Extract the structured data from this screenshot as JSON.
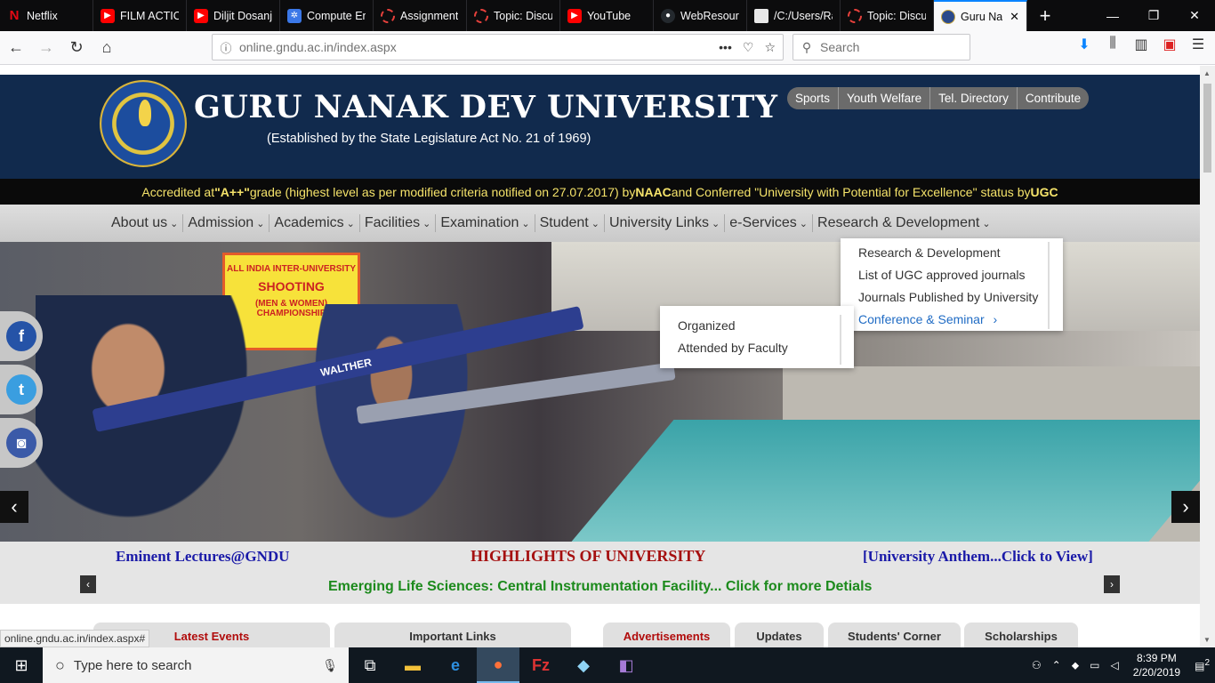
{
  "browser": {
    "tabs": [
      {
        "label": "Netflix",
        "icon": "netflix-icon"
      },
      {
        "label": "FILM ACTIO",
        "icon": "youtube-icon"
      },
      {
        "label": "Diljit Dosanj",
        "icon": "youtube-icon"
      },
      {
        "label": "Compute En",
        "icon": "chip-icon"
      },
      {
        "label": "Assignment",
        "icon": "ring-icon"
      },
      {
        "label": "Topic: Discu",
        "icon": "ring-icon"
      },
      {
        "label": "YouTube",
        "icon": "youtube-icon"
      },
      {
        "label": "WebResour",
        "icon": "github-icon"
      },
      {
        "label": "/C:/Users/Rajwi",
        "icon": "document-icon"
      },
      {
        "label": "Topic: Discu",
        "icon": "ring-icon"
      },
      {
        "label": "Guru Na",
        "icon": "gndu-icon",
        "active": true
      }
    ],
    "url_domain": "online.gndu.ac.in",
    "url_path": "/index.aspx",
    "search_placeholder": "Search",
    "status_url": "online.gndu.ac.in/index.aspx#"
  },
  "header": {
    "title": "GURU NANAK DEV UNIVERSITY",
    "subtitle": "(Established by the State Legislature Act No. 21 of 1969)",
    "top_links": [
      "Sports",
      "Youth Welfare",
      "Tel. Directory",
      "Contribute"
    ]
  },
  "ticker": {
    "p1": "Accredited at ",
    "p2": "\"A++\"",
    "p3": " grade (highest level as per modified criteria notified on 27.07.2017) by ",
    "p4": "NAAC",
    "p5": " and Conferred \"University with Potential for Excellence\" status by ",
    "p6": "UGC"
  },
  "menu": [
    "About us",
    "Admission",
    "Academics",
    "Facilities",
    "Examination",
    "Student",
    "University Links",
    "e-Services",
    "Research & Development"
  ],
  "research_dropdown": [
    "Research & Development",
    "List of UGC approved journals",
    "Journals Published by University",
    "Conference & Seminar"
  ],
  "conference_submenu": [
    "Organized",
    "Attended by Faculty"
  ],
  "hero": {
    "banner_line1": "ALL INDIA INTER-UNIVERSITY",
    "banner_line2": "SHOOTING",
    "banner_line3": "(MEN & WOMEN) CHAMPIONSHIP",
    "rifle_text": "WALTHER"
  },
  "highlights": {
    "left": "Eminent Lectures@GNDU",
    "middle": "HIGHLIGHTS OF UNIVERSITY",
    "right": "[University Anthem...Click to View]",
    "news": "Emerging Life Sciences: Central Instrumentation Facility... Click for more Detials"
  },
  "bottom_tabs": [
    "Latest Events",
    "Important Links",
    "Advertisements",
    "Updates",
    "Students' Corner",
    "Scholarships"
  ],
  "taskbar": {
    "search_placeholder": "Type here to search",
    "time": "8:39 PM",
    "date": "2/20/2019",
    "notification_count": "2"
  }
}
